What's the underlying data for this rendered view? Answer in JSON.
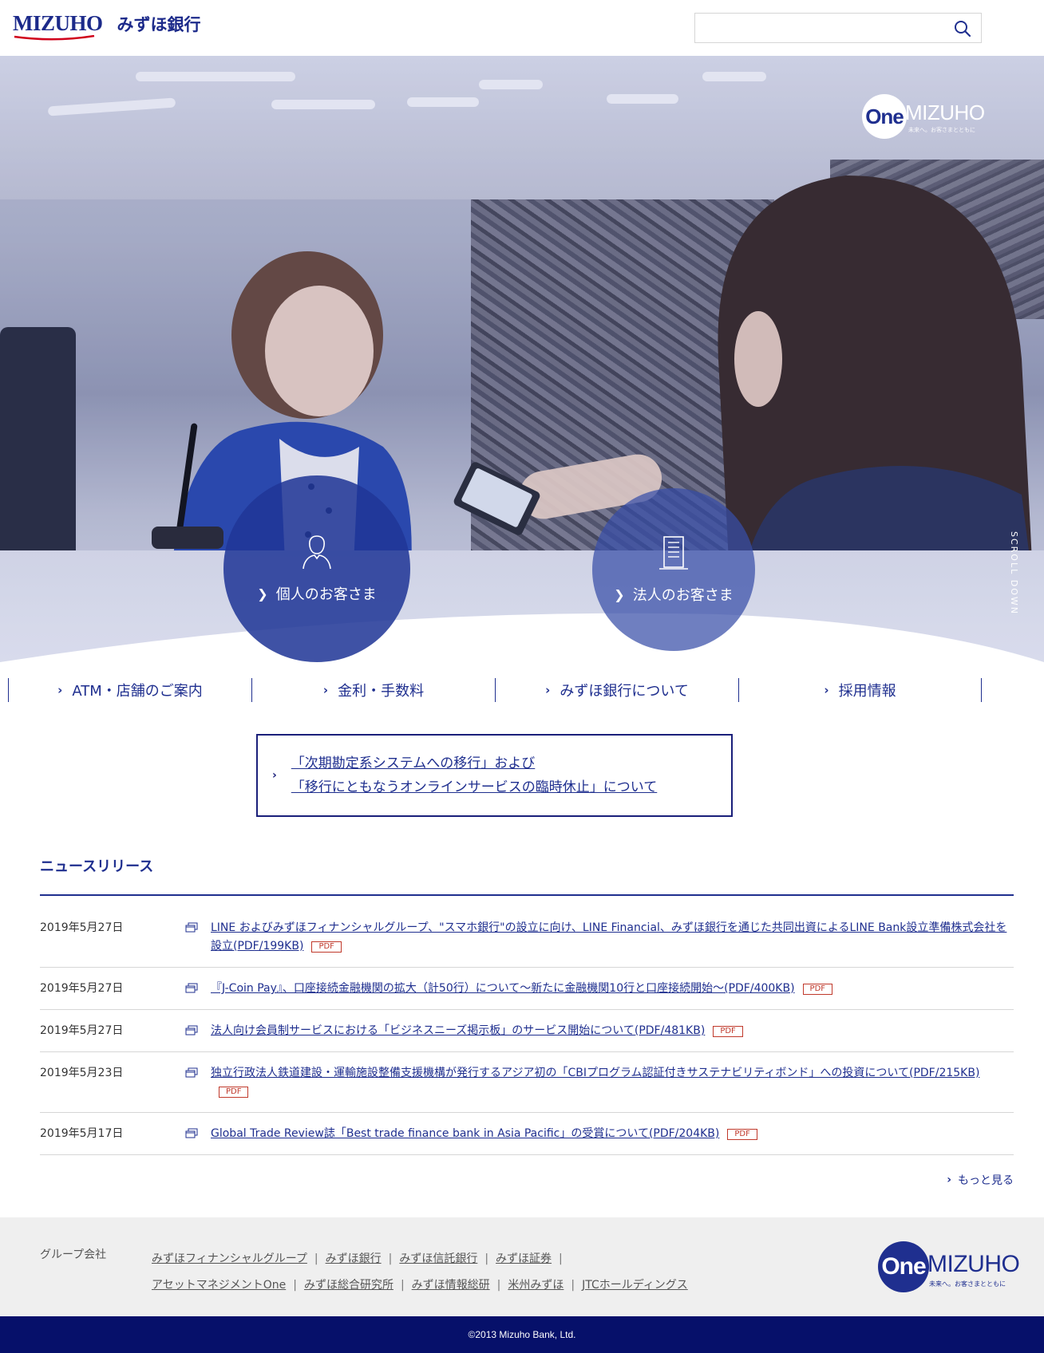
{
  "header": {
    "logo_en": "MIZUHO",
    "logo_ja": "みずほ銀行",
    "search_placeholder": "",
    "search_icon": "search-icon"
  },
  "hero": {
    "brand_one": "One",
    "brand_mizuho": "MIZUHO",
    "brand_tagline": "未来へ。お客さまとともに",
    "scroll_down": "SCROLL DOWN",
    "personal": {
      "label": "個人のお客さま",
      "icon": "person-icon"
    },
    "corporate": {
      "label": "法人のお客さま",
      "icon": "building-icon"
    }
  },
  "subnav": {
    "items": [
      {
        "label": "ATM・店舗のご案内"
      },
      {
        "label": "金利・手数料"
      },
      {
        "label": "みずほ銀行について"
      },
      {
        "label": "採用情報"
      }
    ]
  },
  "notice": {
    "line1": "「次期勘定系システムへの移行」および",
    "line2": "「移行にともなうオンラインサービスの臨時休止」について"
  },
  "news": {
    "title": "ニュースリリース",
    "pdf_label": "PDF",
    "items": [
      {
        "date": "2019年5月27日",
        "text": "LINE およびみずほフィナンシャルグループ、\"スマホ銀行\"の設立に向け、LINE Financial、みずほ銀行を通じた共同出資によるLINE Bank設立準備株式会社を設立(PDF/199KB)"
      },
      {
        "date": "2019年5月27日",
        "text": "『J-Coin Pay』、口座接続金融機関の拡大（計50行）について～新たに金融機関10行と口座接続開始～(PDF/400KB)"
      },
      {
        "date": "2019年5月27日",
        "text": "法人向け会員制サービスにおける「ビジネスニーズ掲示板」のサービス開始について(PDF/481KB)"
      },
      {
        "date": "2019年5月23日",
        "text": "独立行政法人鉄道建設・運輸施設整備支援機構が発行するアジア初の「CBIプログラム認証付きサステナビリティボンド」への投資について(PDF/215KB)"
      },
      {
        "date": "2019年5月17日",
        "text": "Global Trade Review誌「Best trade finance bank in Asia Pacific」の受賞について(PDF/204KB)"
      }
    ],
    "more": "もっと見る"
  },
  "footer": {
    "group_label": "グループ会社",
    "links_row1": [
      "みずほフィナンシャルグループ",
      "みずほ銀行",
      "みずほ信託銀行",
      "みずほ証券"
    ],
    "links_row2": [
      "アセットマネジメントOne",
      "みずほ総合研究所",
      "みずほ情報総研",
      "米州みずほ",
      "JTCホールディングス"
    ],
    "brand_one": "One",
    "brand_mizuho": "MIZUHO",
    "brand_tagline": "未来へ。お客さまとともに",
    "copyright": "©2013 Mizuho Bank, Ltd."
  },
  "colors": {
    "brand_navy": "#1f2f8f",
    "footer_bar": "#06106a",
    "pdf_red": "#c0392b"
  }
}
